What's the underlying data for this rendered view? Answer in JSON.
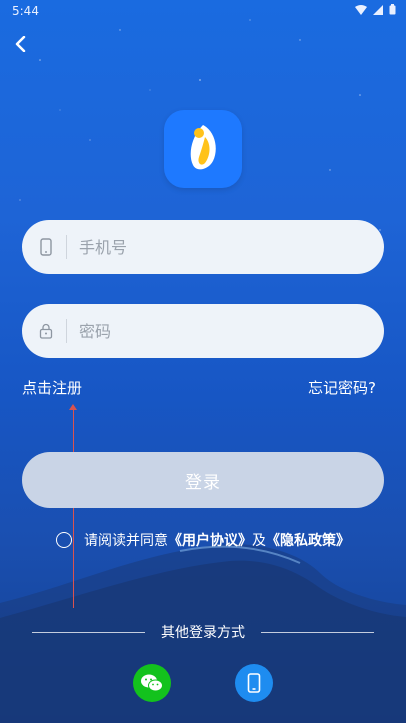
{
  "status_bar": {
    "time": "5:44"
  },
  "login": {
    "phone_placeholder": "手机号",
    "password_placeholder": "密码",
    "register_link": "点击注册",
    "forgot_link": "忘记密码?",
    "login_button": "登录",
    "agreement": {
      "prefix": "请阅读并同意",
      "user_agreement": "《用户协议》",
      "and": "及",
      "privacy_policy": "《隐私政策》"
    },
    "other_methods": "其他登录方式"
  },
  "colors": {
    "logo_bg": "#1e79ff",
    "wechat": "#13c21d",
    "phone_login": "#1e8cf0",
    "login_btn": "#c9d4e6"
  },
  "icons": [
    "back-icon",
    "app-logo-icon",
    "phone-icon",
    "lock-icon",
    "wechat-icon",
    "mobile-icon"
  ]
}
